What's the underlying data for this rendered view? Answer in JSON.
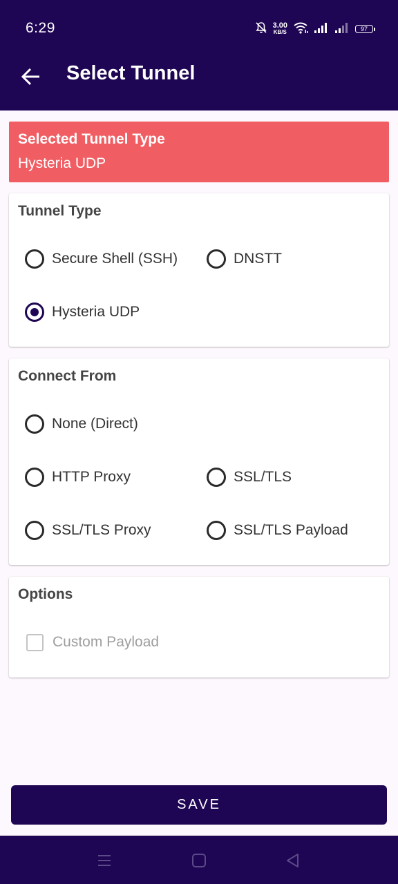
{
  "status_bar": {
    "time": "6:29",
    "net_speed_value": "3.00",
    "net_speed_unit": "KB/S",
    "battery": "97"
  },
  "app_bar": {
    "title": "Select Tunnel",
    "back_icon": "arrow-left-icon"
  },
  "selected_banner": {
    "label": "Selected Tunnel Type",
    "value": "Hysteria UDP",
    "color": "#f05d63"
  },
  "tunnel_type": {
    "title": "Tunnel Type",
    "options": [
      {
        "label": "Secure Shell (SSH)",
        "checked": false
      },
      {
        "label": "DNSTT",
        "checked": false
      },
      {
        "label": "Hysteria UDP",
        "checked": true
      }
    ]
  },
  "connect_from": {
    "title": "Connect From",
    "options": [
      {
        "label": "None (Direct)",
        "checked": false
      },
      {
        "label": "HTTP Proxy",
        "checked": false
      },
      {
        "label": "SSL/TLS",
        "checked": false
      },
      {
        "label": "SSL/TLS Proxy",
        "checked": false
      },
      {
        "label": "SSL/TLS Payload",
        "checked": false
      }
    ]
  },
  "options": {
    "title": "Options",
    "custom_payload": {
      "label": "Custom Payload",
      "checked": false,
      "enabled": false
    }
  },
  "save_button": {
    "label": "SAVE"
  },
  "nav_bar": {
    "items": [
      "menu-icon",
      "home-square-icon",
      "back-triangle-icon"
    ]
  },
  "colors": {
    "primary": "#1f0654",
    "accent": "#f05d63",
    "background": "#fdf8fd"
  }
}
